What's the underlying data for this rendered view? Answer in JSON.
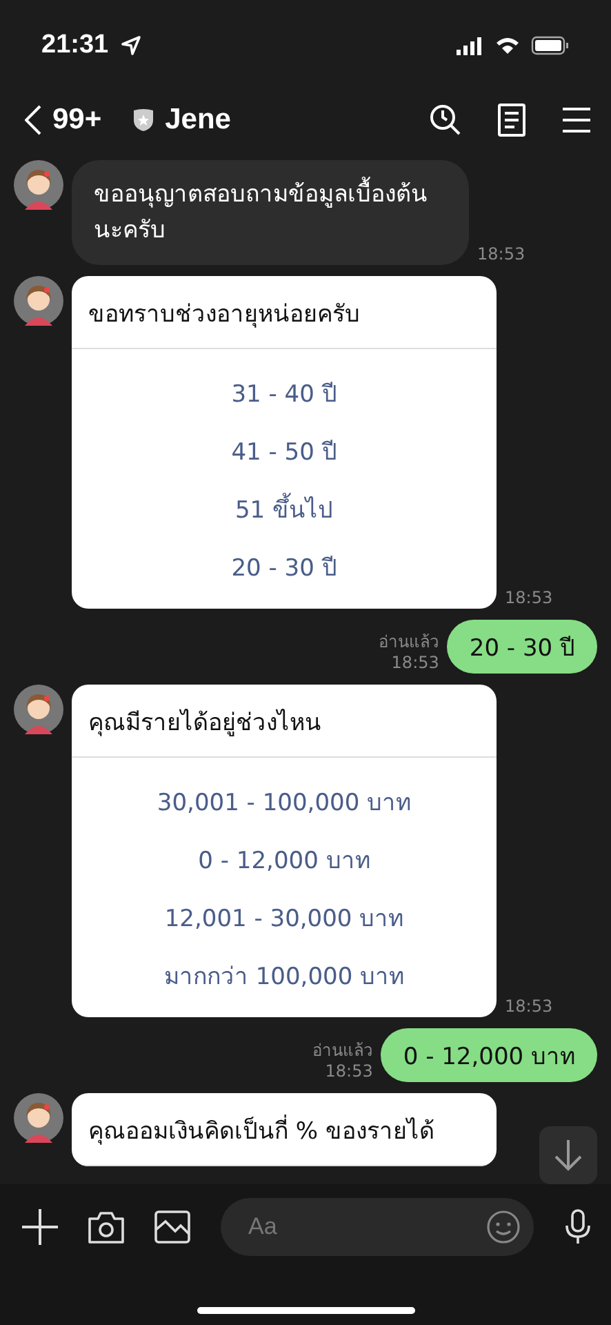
{
  "status_bar": {
    "time": "21:31"
  },
  "header": {
    "unread_count": "99+",
    "contact_name": "Jene"
  },
  "messages": [
    {
      "kind": "text",
      "text": "ขออนุญาตสอบถามข้อมูลเบื้องต้นนะครับ",
      "time": "18:53"
    },
    {
      "kind": "card",
      "question": "ขอทราบช่วงอายุหน่อยครับ",
      "options": [
        "31 - 40 ปี",
        "41 - 50 ปี",
        "51 ขึ้นไป",
        "20 - 30 ปี"
      ],
      "time": "18:53"
    },
    {
      "kind": "reply",
      "text": "20 - 30 ปี",
      "read": "อ่านแล้ว",
      "time": "18:53"
    },
    {
      "kind": "card",
      "question": "คุณมีรายได้อยู่ช่วงไหน",
      "options": [
        "30,001 - 100,000 บาท",
        "0 - 12,000 บาท",
        "12,001 - 30,000 บาท",
        "มากกว่า 100,000 บาท"
      ],
      "time": "18:53"
    },
    {
      "kind": "reply",
      "text": "0 - 12,000 บาท",
      "read": "อ่านแล้ว",
      "time": "18:53"
    },
    {
      "kind": "card",
      "question": "คุณออมเงินคิดเป็นกี่ % ของรายได้"
    }
  ],
  "composer": {
    "placeholder": "Aa"
  }
}
